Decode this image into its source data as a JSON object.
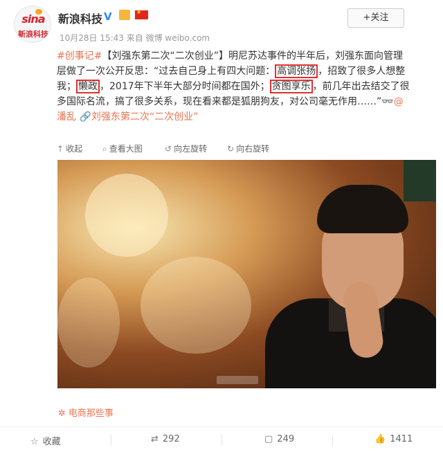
{
  "header": {
    "user_name": "新浪科技",
    "verified": "V",
    "meta": "10月28日 15:43 来自 微博 weibo.com",
    "follow_label": "+关注",
    "avatar_top": "sina",
    "avatar_bottom": "新浪科技"
  },
  "post": {
    "line1": {
      "topic": "#创事记#",
      "rest": "【刘强东第二次“二次创业”】明尼苏达事件的半年后，刘强东面向管理"
    },
    "line2": {
      "pre": "层做了一次公开反思：“过去自己身上有四大问题：",
      "hl": "高调张扬",
      "post": "，招致了很多人想整"
    },
    "line3": {
      "pre": "我；",
      "hl1": "懒政",
      "mid": "，2017年下半年大部分时间都在国外；",
      "hl2": "贪图享乐",
      "post": "，前几年出去结交了很"
    },
    "line4": {
      "text": "多国际名流，搞了很多关系，现在看来都是狐朋狗友，对公司毫无作用……”",
      "emoji": "👓",
      "at": "@"
    },
    "line5": {
      "at_name": "潘乱",
      "link": "刘强东第二次“二次创业”"
    }
  },
  "actions": {
    "collapse": "收起",
    "view_large": "查看大图",
    "rotate_left": "向左旋转",
    "rotate_right": "向右旋转"
  },
  "topic_tag": "电商那些事",
  "footer": {
    "favorite": "收藏",
    "reposts": "292",
    "comments": "249",
    "likes": "1411"
  },
  "colors": {
    "link": "#eb7350",
    "highlight_box": "#e02f2f",
    "verified": "#2c8be8"
  }
}
